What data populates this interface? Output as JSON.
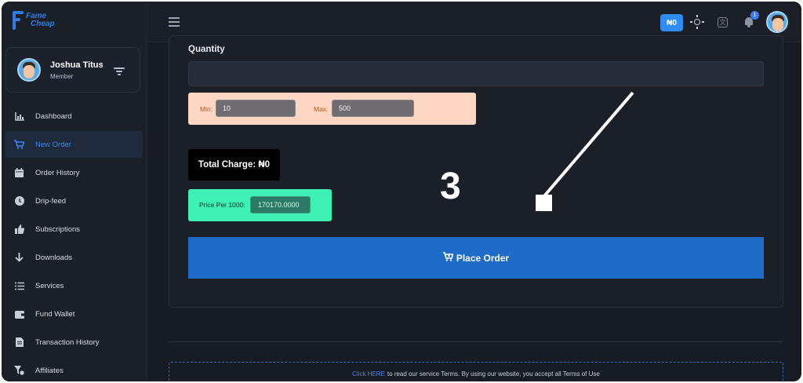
{
  "brand": {
    "line1": "Fame",
    "line2": "Cheap"
  },
  "profile": {
    "name": "Joshua Titus",
    "role": "Member"
  },
  "sidebar": {
    "items": [
      {
        "label": "Dashboard",
        "icon": "chart-icon"
      },
      {
        "label": "New Order",
        "icon": "cart-icon",
        "active": true
      },
      {
        "label": "Order History",
        "icon": "calendar-icon"
      },
      {
        "label": "Drip-feed",
        "icon": "clock-icon"
      },
      {
        "label": "Subscriptions",
        "icon": "thumbs-up-icon"
      },
      {
        "label": "Downloads",
        "icon": "arrow-down-icon"
      },
      {
        "label": "Services",
        "icon": "list-icon"
      },
      {
        "label": "Fund Wallet",
        "icon": "wallet-icon"
      },
      {
        "label": "Transaction History",
        "icon": "receipt-icon"
      },
      {
        "label": "Affiliates",
        "icon": "affiliate-icon"
      }
    ]
  },
  "topbar": {
    "balance": "₦0",
    "notification_count": "1"
  },
  "form": {
    "quantity_label": "Quantity",
    "quantity_value": "",
    "min_label": "Min:",
    "min_value": "10",
    "max_label": "Max:",
    "max_value": "500",
    "total_charge": "Total Charge: ₦0",
    "price_per_label": "Price Per 1000:",
    "price_per_value": "170170.0000",
    "place_order_label": "Place Order"
  },
  "annotation": {
    "step": "3"
  },
  "footer": {
    "link_text": "Click HERE",
    "text": "to read our service Terms. By using our website, you accept all Terms of Use"
  },
  "colors": {
    "accent": "#1f6bc8",
    "minmax_bg": "#fdd6c4",
    "price_bg": "#3ff0b4",
    "charge_bg": "#000000"
  }
}
